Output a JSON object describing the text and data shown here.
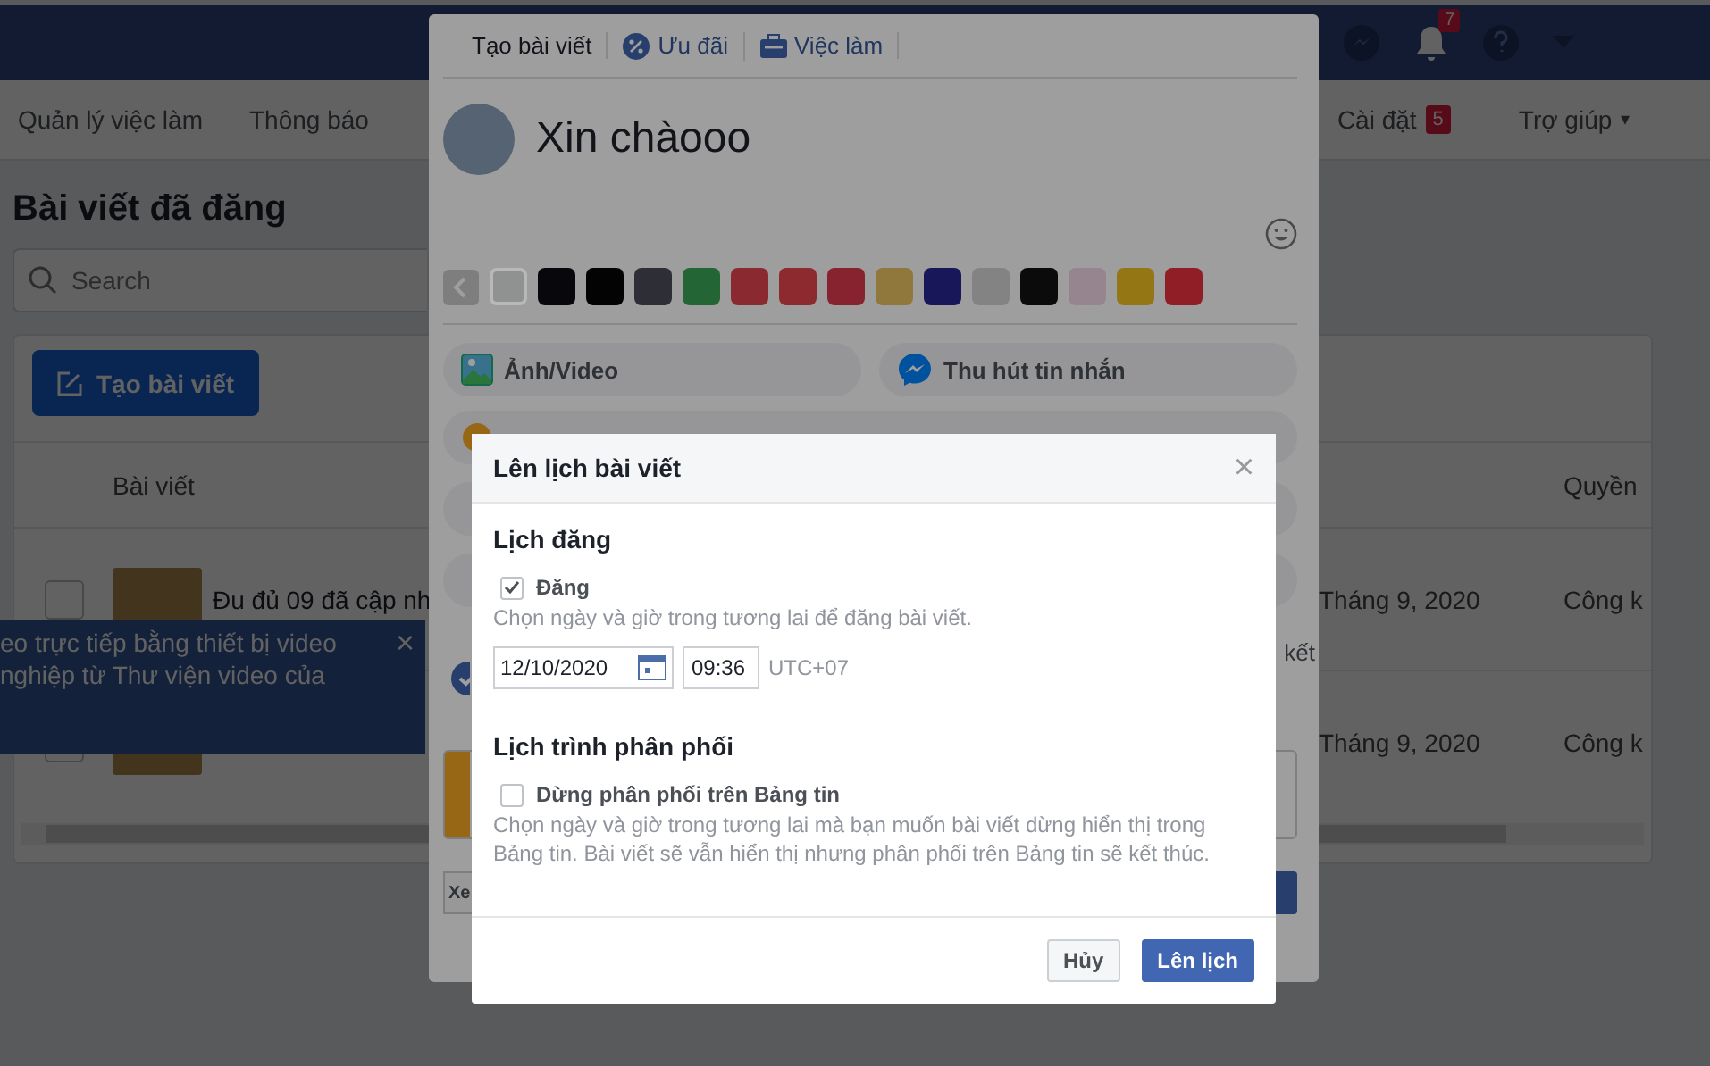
{
  "top_bar": {
    "notifications_badge": "7"
  },
  "nav": {
    "items": [
      {
        "label": "Quản lý việc làm"
      },
      {
        "label": "Thông báo"
      },
      {
        "label": "Cài đặt",
        "badge": "5"
      },
      {
        "label": "Trợ giúp",
        "caret": "▾"
      }
    ]
  },
  "page": {
    "heading": "Bài viết đã đăng",
    "search": {
      "placeholder": "Search"
    },
    "create_button": "Tạo bài viết",
    "table": {
      "columns": [
        "",
        "Bài viết",
        "",
        "Quyền"
      ],
      "rows": [
        {
          "checked": false,
          "title": "Đu đủ 09 đã cập nh",
          "date": "Tháng 9, 2020",
          "permission": "Công k"
        },
        {
          "checked": false,
          "title": "",
          "date": "Tháng 9, 2020",
          "permission": "Công k"
        }
      ]
    }
  },
  "toast": {
    "lines": [
      "eo trực tiếp bằng thiết bị video",
      "nghiệp từ Thư viện video của"
    ],
    "close": "×"
  },
  "composer": {
    "tabs": [
      {
        "label": "Tạo bài viết",
        "selected": true
      },
      {
        "label": "Ưu đãi",
        "selected": false
      },
      {
        "label": "Việc làm",
        "selected": false
      }
    ],
    "text": "Xin chàooo",
    "swatches": [
      {
        "color": "#909191",
        "selected": true
      },
      {
        "color": "#08080c",
        "selected": false
      },
      {
        "color": "#030303",
        "selected": false
      },
      {
        "color": "#2e2e36",
        "selected": false
      },
      {
        "color": "#246536",
        "selected": false
      },
      {
        "color": "#8b2931",
        "selected": false
      },
      {
        "color": "#8d2a30",
        "selected": false
      },
      {
        "color": "#86232e",
        "selected": false
      },
      {
        "color": "#90773b",
        "selected": false
      },
      {
        "color": "#171759",
        "selected": false
      },
      {
        "color": "#838383",
        "selected": false
      },
      {
        "color": "#0b0b0b",
        "selected": false
      },
      {
        "color": "#96858f",
        "selected": false
      },
      {
        "color": "#947614",
        "selected": false
      },
      {
        "color": "#901e27",
        "selected": false
      }
    ],
    "actions": [
      {
        "label": "Ảnh/Video"
      },
      {
        "label": "Thu hút tin nhắn"
      }
    ],
    "partial_text": "kết",
    "partial_button": "Xe"
  },
  "dialog": {
    "title": "Lên lịch bài viết",
    "close": "×",
    "sections": [
      {
        "heading": "Lịch đăng",
        "option": {
          "label": "Đăng",
          "checked": true
        },
        "help": "Chọn ngày và giờ trong tương lai để đăng bài viết.",
        "date": "12/10/2020",
        "time": "09:36",
        "timezone": "UTC+07"
      },
      {
        "heading": "Lịch trình phân phối",
        "option": {
          "label": "Dừng phân phối trên Bảng tin",
          "checked": false
        },
        "help": "Chọn ngày và giờ trong tương lai mà bạn muốn bài viết dừng hiển thị trong Bảng tin. Bài viết sẽ vẫn hiển thị nhưng phân phối trên Bảng tin sẽ kết thúc."
      }
    ],
    "buttons": [
      {
        "label": "Hủy",
        "kind": "secondary"
      },
      {
        "label": "Lên lịch",
        "kind": "primary"
      }
    ]
  }
}
